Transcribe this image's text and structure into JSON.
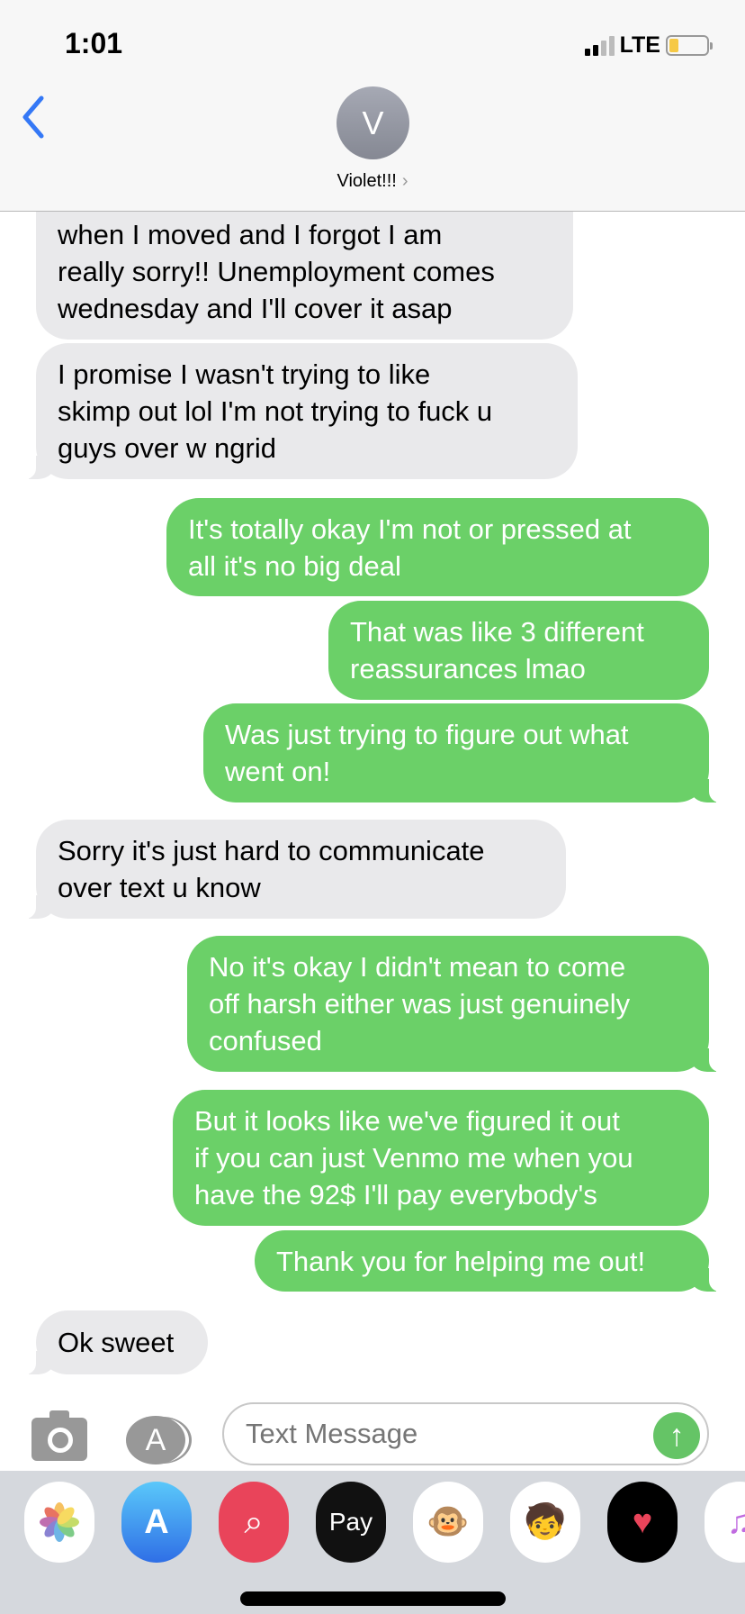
{
  "status_bar": {
    "time": "1:01",
    "network": "LTE",
    "battery_level": 0.25
  },
  "header": {
    "avatar_initial": "V",
    "contact_name": "Violet!!!"
  },
  "messages": [
    {
      "from": "them",
      "lines": [
        "when I moved and I forgot I am",
        "really sorry!! Unemployment comes",
        "wednesday and I'll cover it asap"
      ]
    },
    {
      "from": "them",
      "lines": [
        "I promise I wasn't trying to like",
        "skimp out lol I'm not trying to fuck u",
        "guys over w ngrid"
      ]
    },
    {
      "from": "me",
      "lines": [
        "It's totally okay I'm not or pressed at",
        "all it's no big deal"
      ]
    },
    {
      "from": "me",
      "lines": [
        "That was like 3 different",
        "reassurances lmao"
      ]
    },
    {
      "from": "me",
      "lines": [
        "Was just trying to figure out what",
        "went on!"
      ]
    },
    {
      "from": "them",
      "lines": [
        "Sorry it's just hard to communicate",
        "over text u know"
      ]
    },
    {
      "from": "me",
      "lines": [
        "No it's okay I didn't mean to come",
        "off harsh either was just genuinely",
        "confused"
      ]
    },
    {
      "from": "me",
      "lines": [
        "But it looks like we've figured it out",
        "if you can just Venmo me when you",
        "have the 92$ I'll pay everybody's"
      ]
    },
    {
      "from": "me",
      "lines": [
        "Thank you for helping me out!"
      ]
    },
    {
      "from": "them",
      "lines": [
        "Ok sweet"
      ]
    }
  ],
  "composer": {
    "placeholder": "Text Message"
  },
  "app_tray": {
    "applepay_label": "Pay",
    "apps": [
      "photos",
      "app-store",
      "web-search",
      "apple-pay",
      "animoji",
      "memoji",
      "digital-touch",
      "music"
    ]
  },
  "colors": {
    "sent": "#6bd068",
    "received": "#e9e9eb",
    "accent": "#3478f6"
  }
}
